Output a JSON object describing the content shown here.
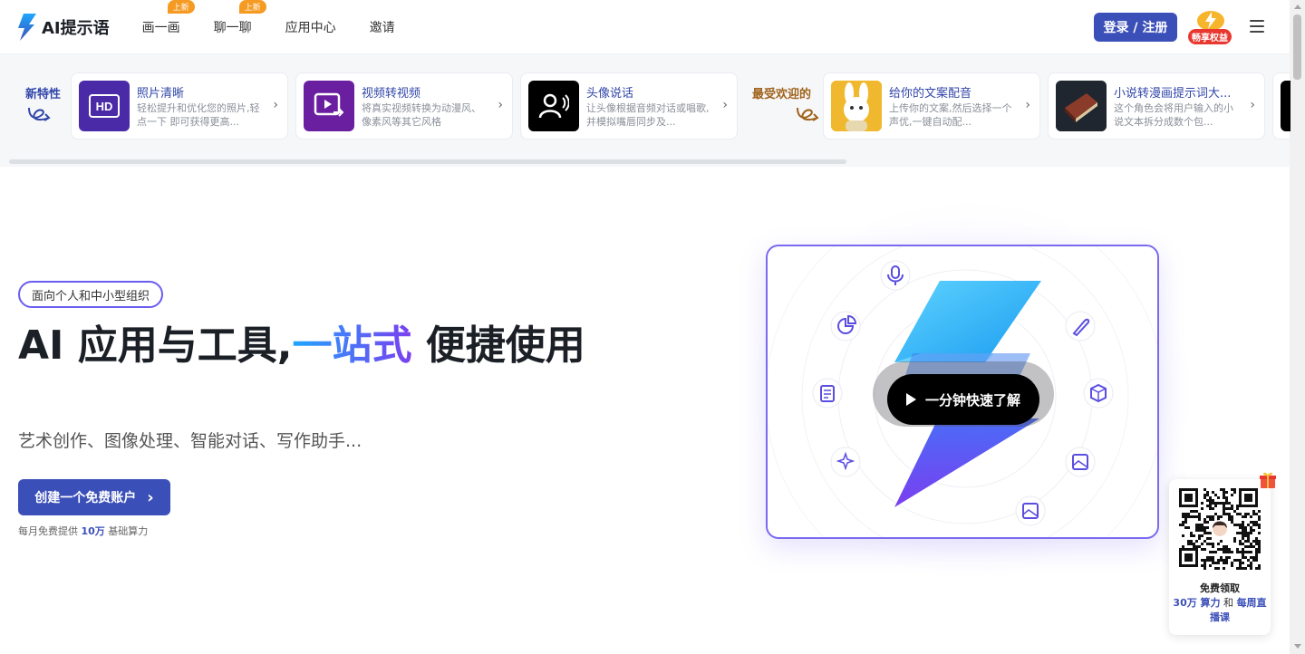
{
  "nav": {
    "logo_text": "AI提示语",
    "menu": [
      {
        "label": "画一画",
        "badge": "上新"
      },
      {
        "label": "聊一聊",
        "badge": "上新"
      },
      {
        "label": "应用中心",
        "badge": ""
      },
      {
        "label": "邀请",
        "badge": ""
      }
    ],
    "login_label": "登录 / 注册",
    "vip_label": "畅享权益"
  },
  "features": {
    "new_heading": "新特性",
    "popular_heading": "最受欢迎的",
    "cards": [
      {
        "title": "照片清晰",
        "desc": "轻松提升和优化您的照片,轻点一下 即可获得更高...",
        "icon": "hd-icon"
      },
      {
        "title": "视频转视频",
        "desc": "将真实视频转换为动漫风、像素风等其它风格",
        "icon": "video-convert-icon"
      },
      {
        "title": "头像说话",
        "desc": "让头像根据音频对话或唱歌,并模拟嘴唇同步及...",
        "icon": "avatar-speak-icon"
      },
      {
        "title": "给你的文案配音",
        "desc": "上传你的文案,然后选择一个声优,一键自动配...",
        "icon": "bunny-thumbnail"
      },
      {
        "title": "小说转漫画提示词大...",
        "desc": "这个角色会将用户输入的小说文本拆分成数个包...",
        "icon": "book-thumbnail"
      }
    ]
  },
  "hero": {
    "tag": "面向个人和中小型组织",
    "headline_a": "AI 应用与工具,",
    "headline_b": "一站式",
    "headline_c": " 便捷使用",
    "subtitle": "艺术创作、图像处理、智能对话、写作助手...",
    "cta_label": "创建一个免费账户",
    "note_a": "每月免费提供 ",
    "note_b": "10万",
    "note_c": " 基础算力",
    "video_label": "一分钟快速了解"
  },
  "qr": {
    "line1": "免费领取",
    "hl1": "30万 算力",
    "mid": " 和 ",
    "hl2": "每周直播课"
  },
  "colors": {
    "primary": "#3b4fb8",
    "accent_orange": "#f59a23",
    "vip_red": "#e8382f"
  }
}
